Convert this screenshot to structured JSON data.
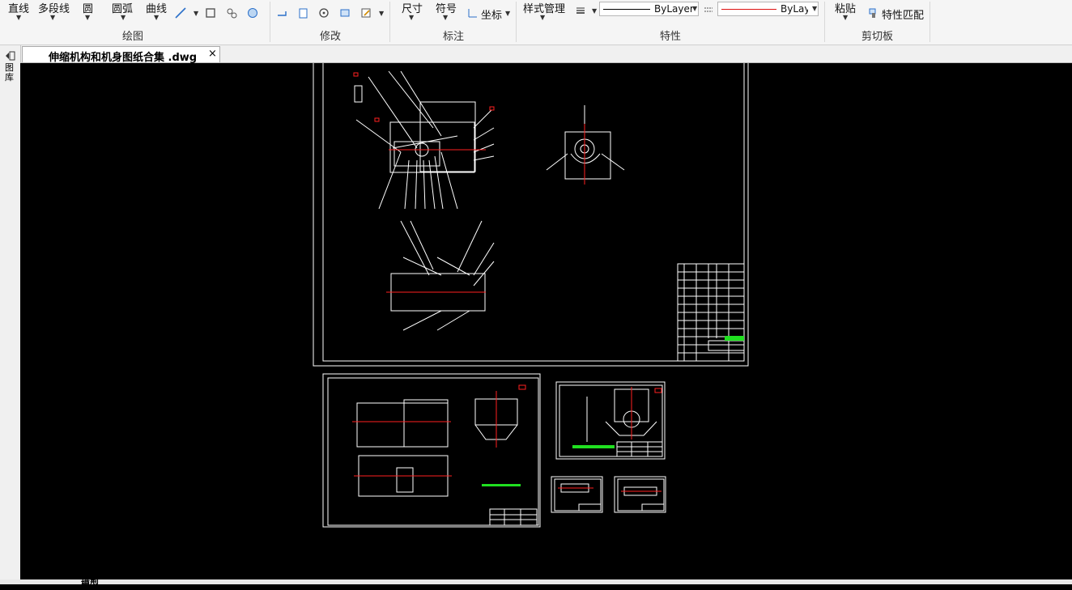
{
  "ribbon": {
    "draw": {
      "line_label": "直线",
      "polyline_label": "多段线",
      "circle_label": "圆",
      "arc_label": "圆弧",
      "curve_label": "曲线",
      "group_label": "绘图"
    },
    "modify": {
      "group_label": "修改"
    },
    "annotate": {
      "dimension_label": "尺寸",
      "symbol_label": "符号",
      "coordinate_label": "坐标",
      "group_label": "标注"
    },
    "properties": {
      "style_manager_label": "样式管理",
      "linetype_value": "ByLayer",
      "color_value": "ByLayer",
      "group_label": "特性"
    },
    "clipboard": {
      "paste_label": "粘贴",
      "match_properties_label": "特性匹配",
      "group_label": "剪切板"
    }
  },
  "document": {
    "tab_title": "伸缩机构和机身图纸合集 .dwg",
    "close_glyph": "×"
  },
  "side_panel": {
    "label": "图库"
  },
  "layout_tabs": [
    "模型"
  ],
  "colors": {
    "canvas": "#000000",
    "drawing_line": "#ffffff",
    "centerline": "#ff2020",
    "dimension_green": "#20e020",
    "color_swatch_line": "#dd1111"
  }
}
